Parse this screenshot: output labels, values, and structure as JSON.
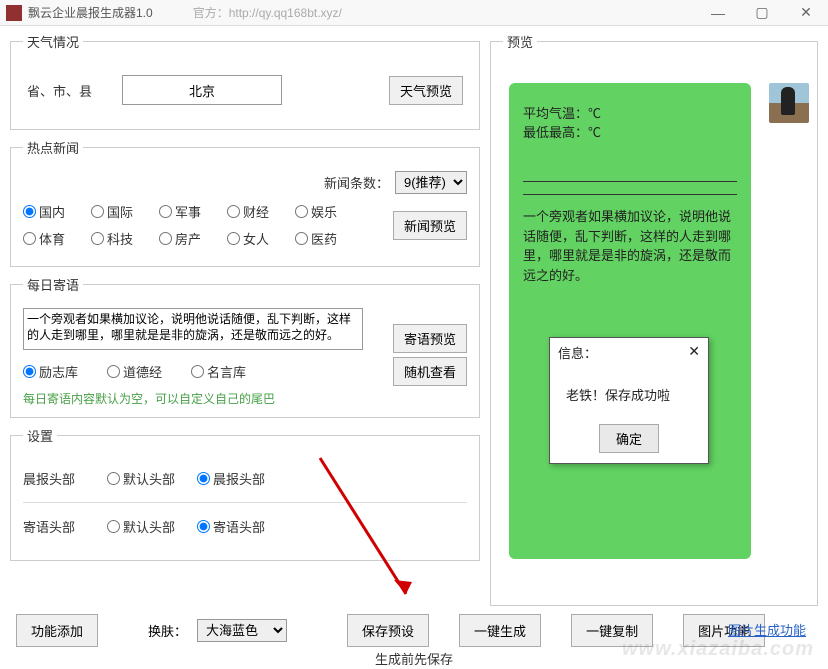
{
  "window": {
    "title": "飘云企业晨报生成器1.0",
    "url": "官方：http://qy.qq168bt.xyz/"
  },
  "weather": {
    "legend": "天气情况",
    "label": "省、市、县",
    "city": "北京",
    "preview_btn": "天气预览"
  },
  "news": {
    "legend": "热点新闻",
    "count_label": "新闻条数：",
    "count_value": "9(推荐)",
    "cats": [
      "国内",
      "国际",
      "军事",
      "财经",
      "娱乐",
      "体育",
      "科技",
      "房产",
      "女人",
      "医药"
    ],
    "selected": "国内",
    "preview_btn": "新闻预览"
  },
  "jiyu": {
    "legend": "每日寄语",
    "text": "一个旁观者如果横加议论，说明他说话随便，乱下判断，这样的人走到哪里，哪里就是是非的旋涡，还是敬而远之的好。",
    "sources": [
      "励志库",
      "道德经",
      "名言库"
    ],
    "selected": "励志库",
    "preview_btn": "寄语预览",
    "random_btn": "随机查看",
    "hint": "每日寄语内容默认为空，可以自定义自己的尾巴"
  },
  "settings": {
    "legend": "设置",
    "head_label": "晨报头部",
    "head_opts": [
      "默认头部",
      "晨报头部"
    ],
    "head_sel": "晨报头部",
    "jiyu_label": "寄语头部",
    "jiyu_opts": [
      "默认头部",
      "寄语头部"
    ],
    "jiyu_sel": "寄语头部"
  },
  "bottom": {
    "add_fn": "功能添加",
    "skin_label": "换肤：",
    "skin_value": "大海蓝色",
    "save_preset": "保存预设",
    "one_gen": "一键生成",
    "one_copy": "一键复制",
    "img_fn": "图片功能",
    "note": "生成前先保存"
  },
  "preview": {
    "legend": "预览",
    "avg_temp": "平均气温：℃",
    "minmax": "最低最高：℃",
    "quote": "一个旁观者如果横加议论，说明他说话随便，乱下判断，这样的人走到哪里，哪里就是是非的旋涡，还是敬而远之的好。",
    "img_gen": "图片生成功能"
  },
  "dialog": {
    "title": "信息：",
    "body": "老铁！保存成功啦",
    "ok": "确定"
  },
  "watermark": "www.xiazaiba.com"
}
